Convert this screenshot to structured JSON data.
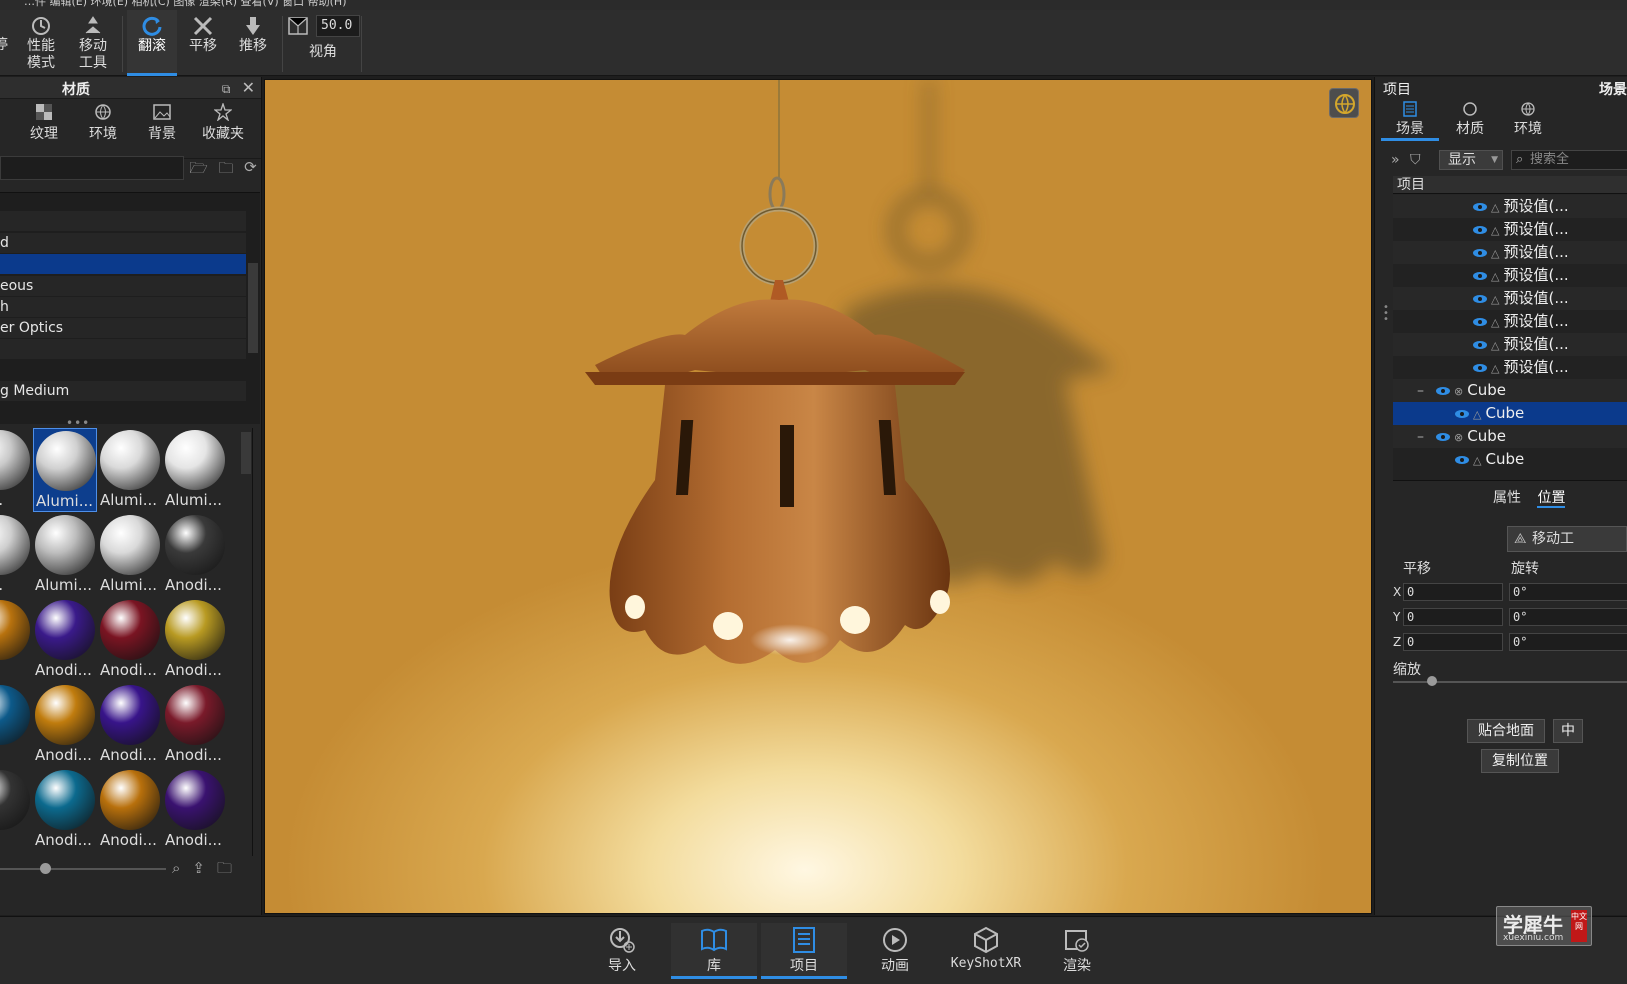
{
  "menu_strip": "…件   编辑(E)   环境(E)   相机(C)   图像   渲染(R)   查看(V)   窗口   帮助(H)",
  "toolbar": {
    "items": [
      {
        "label": "停",
        "icon": "pause-icon"
      },
      {
        "label": "性能\n模式",
        "icon": "performance-mode-icon"
      },
      {
        "label": "移动\n工具",
        "icon": "move-tool-icon"
      },
      {
        "label": "翻滚",
        "icon": "tumble-icon",
        "active": true
      },
      {
        "label": "平移",
        "icon": "pan-icon"
      },
      {
        "label": "推移",
        "icon": "dolly-icon"
      },
      {
        "label": "视角",
        "icon": "perspective-icon"
      }
    ],
    "fov_value": "50.0"
  },
  "library": {
    "title": "材质",
    "tabs": [
      {
        "label": "纹理",
        "icon": "texture-icon"
      },
      {
        "label": "环境",
        "icon": "environment-icon"
      },
      {
        "label": "背景",
        "icon": "background-icon"
      },
      {
        "label": "收藏夹",
        "icon": "favorites-icon"
      }
    ],
    "tree": [
      {
        "label": "",
        "selected": false
      },
      {
        "label": "d",
        "selected": false
      },
      {
        "label": "",
        "selected": true
      },
      {
        "label": "eous",
        "selected": false
      },
      {
        "label": "h",
        "selected": false
      },
      {
        "label": "er Optics",
        "selected": false
      },
      {
        "label": "",
        "selected": false
      },
      {
        "label": "",
        "selected": false
      },
      {
        "label": "g Medium",
        "selected": false
      }
    ],
    "thumbnails": [
      {
        "label": "mi...",
        "color": "#c9c9c9"
      },
      {
        "label": "Alumi...",
        "color": "#d0d0d0",
        "selected": true
      },
      {
        "label": "Alumi...",
        "color": "#dadada"
      },
      {
        "label": "Alumi...",
        "color": "#e5e5e5"
      },
      {
        "label": "mi...",
        "color": "#cfcfcf"
      },
      {
        "label": "Alumi...",
        "color": "#bdbdbd"
      },
      {
        "label": "Alumi...",
        "color": "#d9d9d9"
      },
      {
        "label": "Anodi...",
        "color": "#3a3a3a"
      },
      {
        "label": "di...",
        "color": "#b8720e"
      },
      {
        "label": "Anodi...",
        "color": "#3a1a8a"
      },
      {
        "label": "Anodi...",
        "color": "#7a1422"
      },
      {
        "label": "Anodi...",
        "color": "#b89a22"
      },
      {
        "label": "di...",
        "color": "#0d5a8a"
      },
      {
        "label": "Anodi...",
        "color": "#c07c0e"
      },
      {
        "label": "Anodi...",
        "color": "#38148a"
      },
      {
        "label": "Anodi...",
        "color": "#7a1a2a"
      },
      {
        "label": "di...",
        "color": "#333333"
      },
      {
        "label": "Anodi...",
        "color": "#0c6a8e"
      },
      {
        "label": "Anodi...",
        "color": "#b8700c"
      },
      {
        "label": "Anodi...",
        "color": "#3a1270"
      }
    ]
  },
  "scene_panel": {
    "title": "项目",
    "title_right": "场景",
    "tabs": [
      {
        "label": "场景",
        "icon": "scene-icon",
        "active": true
      },
      {
        "label": "材质",
        "icon": "material-icon"
      },
      {
        "label": "环境",
        "icon": "environment-icon"
      }
    ],
    "show_label": "显示",
    "search_placeholder": "搜索全",
    "tree_header": "项目",
    "tree_rows": [
      {
        "label": "预设值(...",
        "indent": 3
      },
      {
        "label": "预设值(...",
        "indent": 3
      },
      {
        "label": "预设值(...",
        "indent": 3
      },
      {
        "label": "预设值(...",
        "indent": 3
      },
      {
        "label": "预设值(...",
        "indent": 3
      },
      {
        "label": "预设值(...",
        "indent": 3
      },
      {
        "label": "预设值(...",
        "indent": 3
      },
      {
        "label": "预设值(...",
        "indent": 3
      },
      {
        "label": "Cube",
        "indent": 1,
        "group": true
      },
      {
        "label": "Cube",
        "indent": 2,
        "selected": true
      },
      {
        "label": "Cube",
        "indent": 1,
        "group": true
      },
      {
        "label": "Cube",
        "indent": 2
      }
    ],
    "subtabs": [
      "属性",
      "位置"
    ],
    "move_button": "移动工",
    "translate_label": "平移",
    "rotate_label": "旋转",
    "axes": [
      {
        "axis": "X",
        "translate": "0",
        "rotate": "0°"
      },
      {
        "axis": "Y",
        "translate": "0",
        "rotate": "0°"
      },
      {
        "axis": "Z",
        "translate": "0",
        "rotate": "0°"
      }
    ],
    "scale_label": "缩放",
    "snap_ground": "贴合地面",
    "center_label": "中",
    "copy_position": "复制位置"
  },
  "bottom_bar": {
    "items": [
      {
        "label": "导入",
        "icon": "import-icon"
      },
      {
        "label": "库",
        "icon": "library-book-icon",
        "active": true
      },
      {
        "label": "项目",
        "icon": "project-list-icon",
        "active": true
      },
      {
        "label": "动画",
        "icon": "animation-icon"
      },
      {
        "label": "KeyShotXR",
        "icon": "keyshotxr-icon"
      },
      {
        "label": "渲染",
        "icon": "render-icon"
      }
    ]
  },
  "watermark": {
    "text": "学犀牛",
    "sub": "xuexiniu.com",
    "badge": "中文网"
  }
}
